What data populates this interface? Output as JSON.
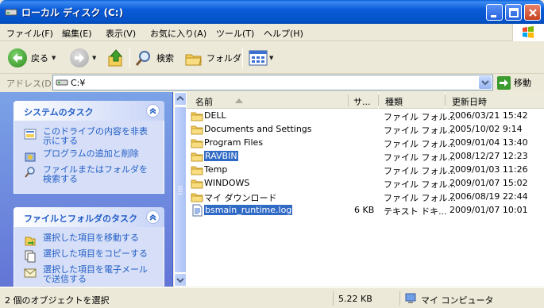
{
  "window": {
    "title": "ローカル ディスク (C:)"
  },
  "menu": [
    "ファイル(F)",
    "編集(E)",
    "表示(V)",
    "お気に入り(A)",
    "ツール(T)",
    "ヘルプ(H)"
  ],
  "toolbar": {
    "back": "戻る",
    "search": "検索",
    "folders": "フォルダ"
  },
  "address": {
    "label": "アドレス(D)",
    "value": "C:¥",
    "go": "移動"
  },
  "tasks": {
    "system": {
      "title": "システムのタスク",
      "items": [
        "このドライブの内容を非表示にする",
        "プログラムの追加と削除",
        "ファイルまたはフォルダを検索する"
      ]
    },
    "filefolder": {
      "title": "ファイルとフォルダのタスク",
      "items": [
        "選択した項目を移動する",
        "選択した項目をコピーする",
        "選択した項目を電子メールで送信する"
      ]
    }
  },
  "columns": {
    "name": "名前",
    "size": "サ...",
    "type": "種類",
    "modified": "更新日時"
  },
  "files": [
    {
      "name": "DELL",
      "size": "",
      "type": "ファイル フォル...",
      "modified": "2006/03/21 15:42",
      "selected": false,
      "kind": "folder"
    },
    {
      "name": "Documents and Settings",
      "size": "",
      "type": "ファイル フォル...",
      "modified": "2005/10/02 9:14",
      "selected": false,
      "kind": "folder"
    },
    {
      "name": "Program Files",
      "size": "",
      "type": "ファイル フォル...",
      "modified": "2009/01/04 13:40",
      "selected": false,
      "kind": "folder"
    },
    {
      "name": "RAVBIN",
      "size": "",
      "type": "ファイル フォル...",
      "modified": "2008/12/27 12:23",
      "selected": true,
      "kind": "folder"
    },
    {
      "name": "Temp",
      "size": "",
      "type": "ファイル フォル...",
      "modified": "2009/01/03 11:26",
      "selected": false,
      "kind": "folder"
    },
    {
      "name": "WINDOWS",
      "size": "",
      "type": "ファイル フォル...",
      "modified": "2009/01/07 15:02",
      "selected": false,
      "kind": "folder"
    },
    {
      "name": "マイ ダウンロード",
      "size": "",
      "type": "ファイル フォル...",
      "modified": "2006/08/19 22:44",
      "selected": false,
      "kind": "folder"
    },
    {
      "name": "bsmain_runtime.log",
      "size": "6 KB",
      "type": "テキスト ドキ...",
      "modified": "2009/01/07 10:01",
      "selected": true,
      "kind": "text"
    }
  ],
  "status": {
    "objects": "2 個のオブジェクトを選択",
    "size": "5.22 KB",
    "location": "マイ コンピュータ"
  }
}
